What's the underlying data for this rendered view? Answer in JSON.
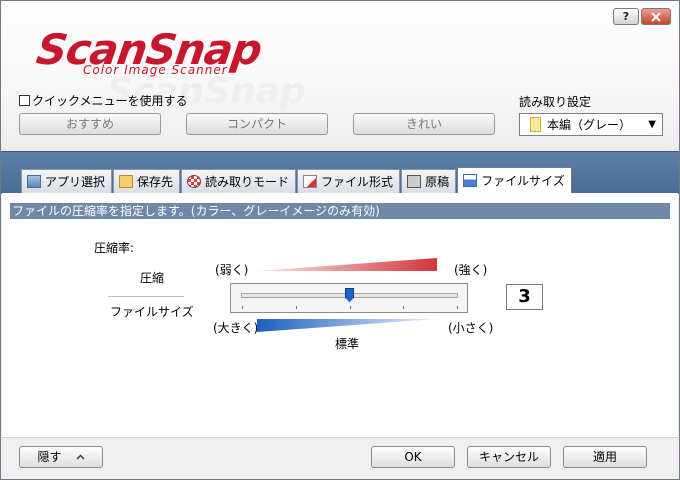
{
  "titlebar": {
    "help_label": "?"
  },
  "logo": {
    "main": "ScanSnap",
    "sub": "Color Image Scanner",
    "watermark": "ScanSnap"
  },
  "quick_menu": {
    "label": "クイックメニューを使用する",
    "checked": false
  },
  "presets": [
    {
      "label": "おすすめ"
    },
    {
      "label": "コンパクト"
    },
    {
      "label": "きれい"
    }
  ],
  "scan_settings": {
    "label": "読み取り設定",
    "value": "本編（グレー）"
  },
  "tabs": [
    {
      "label": "アプリ選択",
      "icon": "application-icon"
    },
    {
      "label": "保存先",
      "icon": "folder-icon"
    },
    {
      "label": "読み取りモード",
      "icon": "scan-mode-icon"
    },
    {
      "label": "ファイル形式",
      "icon": "file-format-icon"
    },
    {
      "label": "原稿",
      "icon": "document-icon"
    },
    {
      "label": "ファイルサイズ",
      "icon": "file-size-icon",
      "active": true
    }
  ],
  "content": {
    "description": "ファイルの圧縮率を指定します。(カラー、グレーイメージのみ有効)",
    "compression_title": "圧縮率:",
    "compression_label": "圧縮",
    "filesize_label": "ファイルサイズ",
    "weak_label": "(弱く)",
    "strong_label": "(強く)",
    "large_label": "(大きく)",
    "small_label": "(小さく)",
    "standard_label": "標準",
    "slider": {
      "min": 1,
      "max": 5,
      "value": 3
    },
    "value_display": "3"
  },
  "buttons": {
    "hide": "隠す",
    "ok": "OK",
    "cancel": "キャンセル",
    "apply": "適用"
  },
  "colors": {
    "brand_red": "#c8172d",
    "band_blue": "#5d7fa8",
    "slider_blue": "#1e63c8"
  }
}
